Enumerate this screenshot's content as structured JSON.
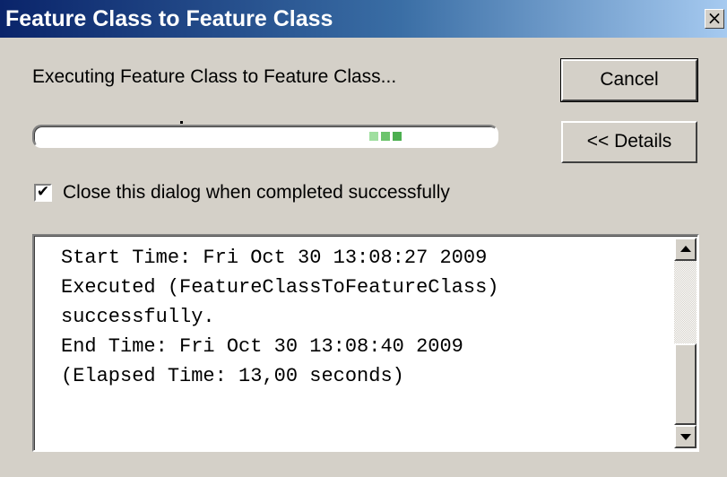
{
  "window": {
    "title": "Feature Class to Feature Class",
    "close_glyph": "×"
  },
  "status": {
    "label": "Executing Feature Class to Feature Class..."
  },
  "buttons": {
    "cancel_label": "Cancel",
    "details_label": "<< Details"
  },
  "progress": {
    "chunk_color": "#4caf50",
    "chunk_colors": [
      "#9fdf9f",
      "#6cc46c",
      "#4caf50"
    ]
  },
  "options": {
    "close_when_done_label": "Close this dialog when completed successfully",
    "close_when_done_checked": true,
    "check_glyph": "✔"
  },
  "log": {
    "lines": [
      "Start Time: Fri Oct 30 13:08:27 2009",
      "Executed (FeatureClassToFeatureClass)",
      "successfully.",
      "End Time: Fri Oct 30 13:08:40 2009",
      "(Elapsed Time: 13,00 seconds)"
    ]
  },
  "colors": {
    "title_bar_start": "#0a246a",
    "title_bar_end": "#a6caf0",
    "dialog_bg": "#d4d0c8"
  }
}
